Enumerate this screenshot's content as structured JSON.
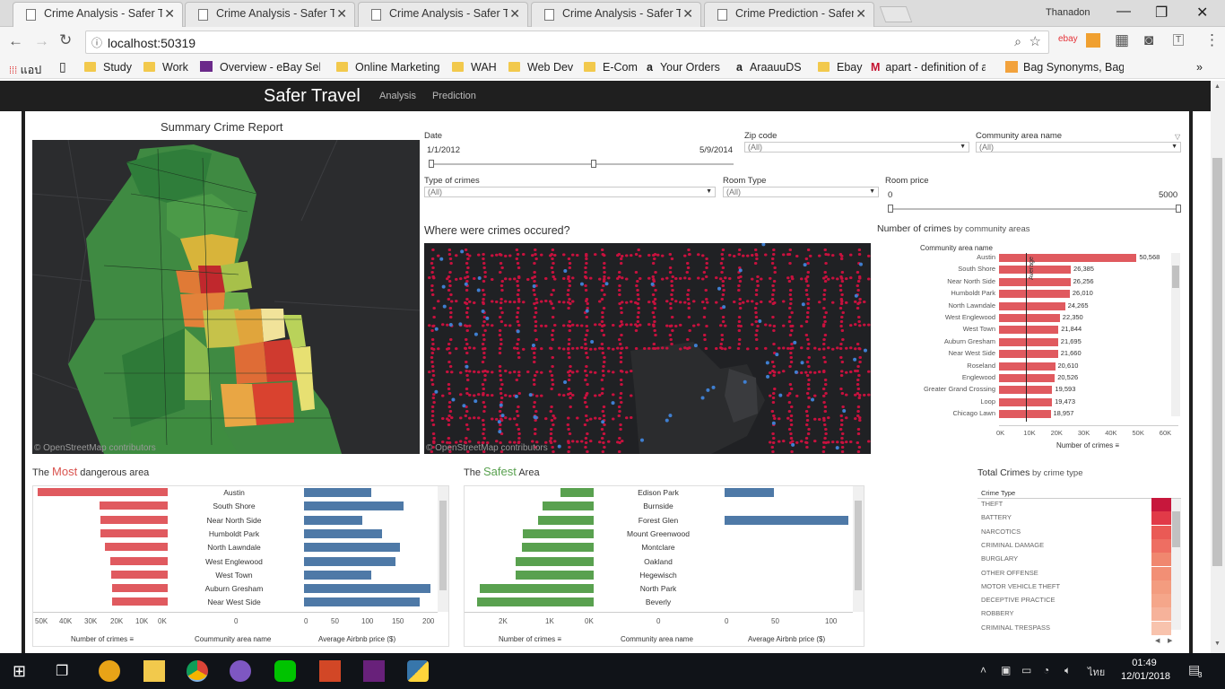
{
  "browser": {
    "tabs": [
      {
        "title": "Crime Analysis - Safer Tra",
        "active": true
      },
      {
        "title": "Crime Analysis - Safer Tra",
        "active": false
      },
      {
        "title": "Crime Analysis - Safer Tra",
        "active": false
      },
      {
        "title": "Crime Analysis - Safer Tra",
        "active": false
      },
      {
        "title": "Crime Prediction - Safer",
        "active": false
      }
    ],
    "user": "Thanadon",
    "url": "localhost:50319",
    "bookmarks": [
      "แอป",
      "Study",
      "Work",
      "Overview - eBay Selle",
      "Online Marketing",
      "WAH",
      "Web Dev",
      "E-Com",
      "Your Orders",
      "AraauuDS",
      "Ebay",
      "apart - definition of a",
      "Bag Synonyms, Bag A"
    ]
  },
  "site": {
    "brand": "Safer Travel",
    "nav": [
      "Analysis",
      "Prediction"
    ]
  },
  "filters": {
    "date_label": "Date",
    "date_start": "1/1/2012",
    "date_end": "5/9/2014",
    "zip_label": "Zip code",
    "zip_value": "(All)",
    "community_label": "Community area name",
    "community_value": "(All)",
    "crime_type_label": "Type of crimes",
    "crime_type_value": "(All)",
    "room_type_label": "Room Type",
    "room_type_value": "(All)",
    "room_price_label": "Room price",
    "room_price_min": "0",
    "room_price_max": "5000"
  },
  "summary_map": {
    "title": "Summary Crime Report",
    "attribution": "© OpenStreetMap contributors"
  },
  "crime_map": {
    "title": "Where were crimes occured?",
    "attribution": "© OpenStreetMap contributors"
  },
  "community_chart": {
    "title_main": "Number of crimes",
    "title_sub": " by community areas",
    "column_header": "Community area name",
    "reference_label": "Average",
    "x_title": "Number of crimes",
    "x_ticks": [
      "0K",
      "10K",
      "20K",
      "30K",
      "40K",
      "50K",
      "60K"
    ],
    "rows": [
      {
        "name": "Austin",
        "value": 50568,
        "label": "50,568"
      },
      {
        "name": "South Shore",
        "value": 26385,
        "label": "26,385"
      },
      {
        "name": "Near North Side",
        "value": 26256,
        "label": "26,256"
      },
      {
        "name": "Humboldt Park",
        "value": 26010,
        "label": "26,010"
      },
      {
        "name": "North Lawndale",
        "value": 24265,
        "label": "24,265"
      },
      {
        "name": "West Englewood",
        "value": 22350,
        "label": "22,350"
      },
      {
        "name": "West Town",
        "value": 21844,
        "label": "21,844"
      },
      {
        "name": "Auburn Gresham",
        "value": 21695,
        "label": "21,695"
      },
      {
        "name": "Near West Side",
        "value": 21660,
        "label": "21,660"
      },
      {
        "name": "Roseland",
        "value": 20610,
        "label": "20,610"
      },
      {
        "name": "Englewood",
        "value": 20526,
        "label": "20,526"
      },
      {
        "name": "Greater Grand Crossing",
        "value": 19593,
        "label": "19,593"
      },
      {
        "name": "Loop",
        "value": 19473,
        "label": "19,473"
      },
      {
        "name": "Chicago Lawn",
        "value": 18957,
        "label": "18,957"
      }
    ]
  },
  "most_dangerous": {
    "title_pre": "The ",
    "title_em": "Most",
    "title_post": " dangerous area",
    "col1": "Number of crimes",
    "col2": "Coummunity area name",
    "col3": "Average Airbnb price ($)",
    "crime_ticks": [
      "50K",
      "40K",
      "30K",
      "20K",
      "10K",
      "0K"
    ],
    "center_tick": "0",
    "price_ticks": [
      "0",
      "50",
      "100",
      "150",
      "200"
    ],
    "rows": [
      {
        "name": "Austin",
        "crimes": 50568,
        "price": 110
      },
      {
        "name": "South Shore",
        "crimes": 26385,
        "price": 163
      },
      {
        "name": "Near North Side",
        "crimes": 26256,
        "price": 95
      },
      {
        "name": "Humboldt Park",
        "crimes": 26010,
        "price": 128
      },
      {
        "name": "North Lawndale",
        "crimes": 24265,
        "price": 157
      },
      {
        "name": "West Englewood",
        "crimes": 22350,
        "price": 150
      },
      {
        "name": "West Town",
        "crimes": 21844,
        "price": 110
      },
      {
        "name": "Auburn Gresham",
        "crimes": 21695,
        "price": 208
      },
      {
        "name": "Near West Side",
        "crimes": 21660,
        "price": 190
      }
    ]
  },
  "safest": {
    "title_pre": "The ",
    "title_em": "Safest",
    "title_post": " Area",
    "col1": "Number of crimes",
    "col2": "Community area name",
    "col3": "Average Airbnb price ($)",
    "crime_ticks": [
      "2K",
      "1K",
      "0K"
    ],
    "center_tick": "0",
    "price_ticks": [
      "0",
      "50",
      "100"
    ],
    "rows": [
      {
        "name": "Edison Park",
        "crimes": 740,
        "price": 50
      },
      {
        "name": "Burnside",
        "crimes": 1150,
        "price": 0
      },
      {
        "name": "Forest Glen",
        "crimes": 1250,
        "price": 125
      },
      {
        "name": "Mount Greenwood",
        "crimes": 1600,
        "price": 0
      },
      {
        "name": "Montclare",
        "crimes": 1620,
        "price": 0
      },
      {
        "name": "Oakland",
        "crimes": 1750,
        "price": 0
      },
      {
        "name": "Hegewisch",
        "crimes": 1760,
        "price": 0
      },
      {
        "name": "North Park",
        "crimes": 2560,
        "price": 0
      },
      {
        "name": "Beverly",
        "crimes": 2630,
        "price": 0
      }
    ]
  },
  "crime_types": {
    "title_main": "Total Crimes",
    "title_sub": " by crime type",
    "header": "Crime Type",
    "items": [
      "THEFT",
      "BATTERY",
      "NARCOTICS",
      "CRIMINAL DAMAGE",
      "BURGLARY",
      "OTHER OFFENSE",
      "MOTOR VEHICLE THEFT",
      "DECEPTIVE PRACTICE",
      "ROBBERY",
      "CRIMINAL TRESPASS"
    ],
    "colors": [
      "#c7173c",
      "#e13a48",
      "#ea5a55",
      "#ee6e62",
      "#f0876f",
      "#f28f75",
      "#f39c7f",
      "#f5a68a",
      "#f6b29a",
      "#f8c3ad"
    ]
  },
  "taskbar": {
    "time": "01:49",
    "date": "12/01/2018",
    "lang": "ไทย",
    "notifications": "3"
  }
}
